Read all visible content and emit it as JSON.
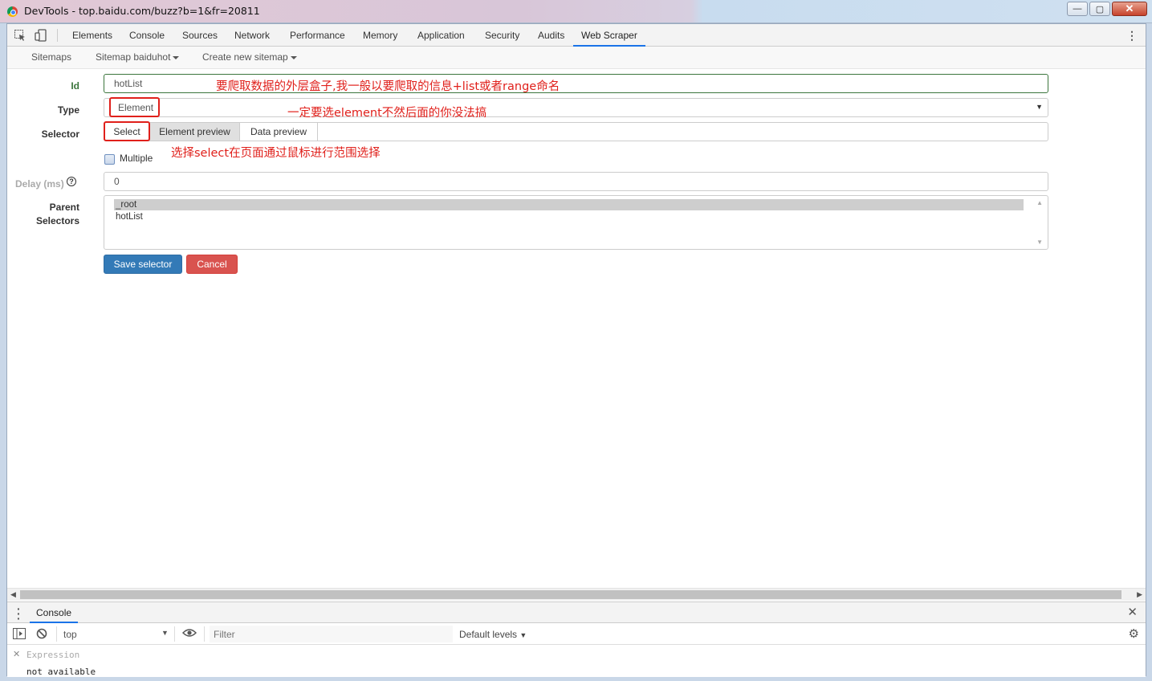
{
  "window": {
    "title": "DevTools - top.baidu.com/buzz?b=1&fr=20811",
    "buttons": {
      "minimize": "—",
      "maximize": "▢",
      "close": "✕"
    }
  },
  "devtools": {
    "tabs": [
      "Elements",
      "Console",
      "Sources",
      "Network",
      "Performance",
      "Memory",
      "Application",
      "Security",
      "Audits",
      "Web Scraper"
    ],
    "active_tab": "Web Scraper",
    "more_icon": "⋮"
  },
  "scraper_nav": {
    "sitemaps": "Sitemaps",
    "sitemap_current": "Sitemap baiduhot",
    "create_new": "Create new sitemap"
  },
  "form": {
    "id_label": "Id",
    "id_value": "hotList",
    "type_label": "Type",
    "type_value": "Element",
    "selector_label": "Selector",
    "select_btn": "Select",
    "element_preview_btn": "Element preview",
    "data_preview_btn": "Data preview",
    "selector_value": "",
    "multiple_label": "Multiple",
    "multiple_checked": false,
    "delay_label": "Delay (ms)",
    "delay_help": "?",
    "delay_value": "0",
    "parent_label_1": "Parent",
    "parent_label_2": "Selectors",
    "parent_options": [
      "_root",
      "hotList"
    ],
    "parent_selected": "_root",
    "save_btn": "Save selector",
    "cancel_btn": "Cancel"
  },
  "annotations": {
    "id_note": "要爬取数据的外层盒子,我一般以要爬取的信息+list或者range命名",
    "type_note": "一定要选element不然后面的你没法搞",
    "select_note": "选择select在页面通过鼠标进行范围选择"
  },
  "drawer": {
    "tab": "Console",
    "context": "top",
    "filter_placeholder": "Filter",
    "levels": "Default levels",
    "expression_label": "Expression",
    "expression_value": "not available"
  },
  "colors": {
    "accent": "#1a73e8",
    "annotation_red": "#e0201b",
    "primary_btn": "#337ab7",
    "danger_btn": "#d9534f",
    "id_green": "#3c763d"
  }
}
